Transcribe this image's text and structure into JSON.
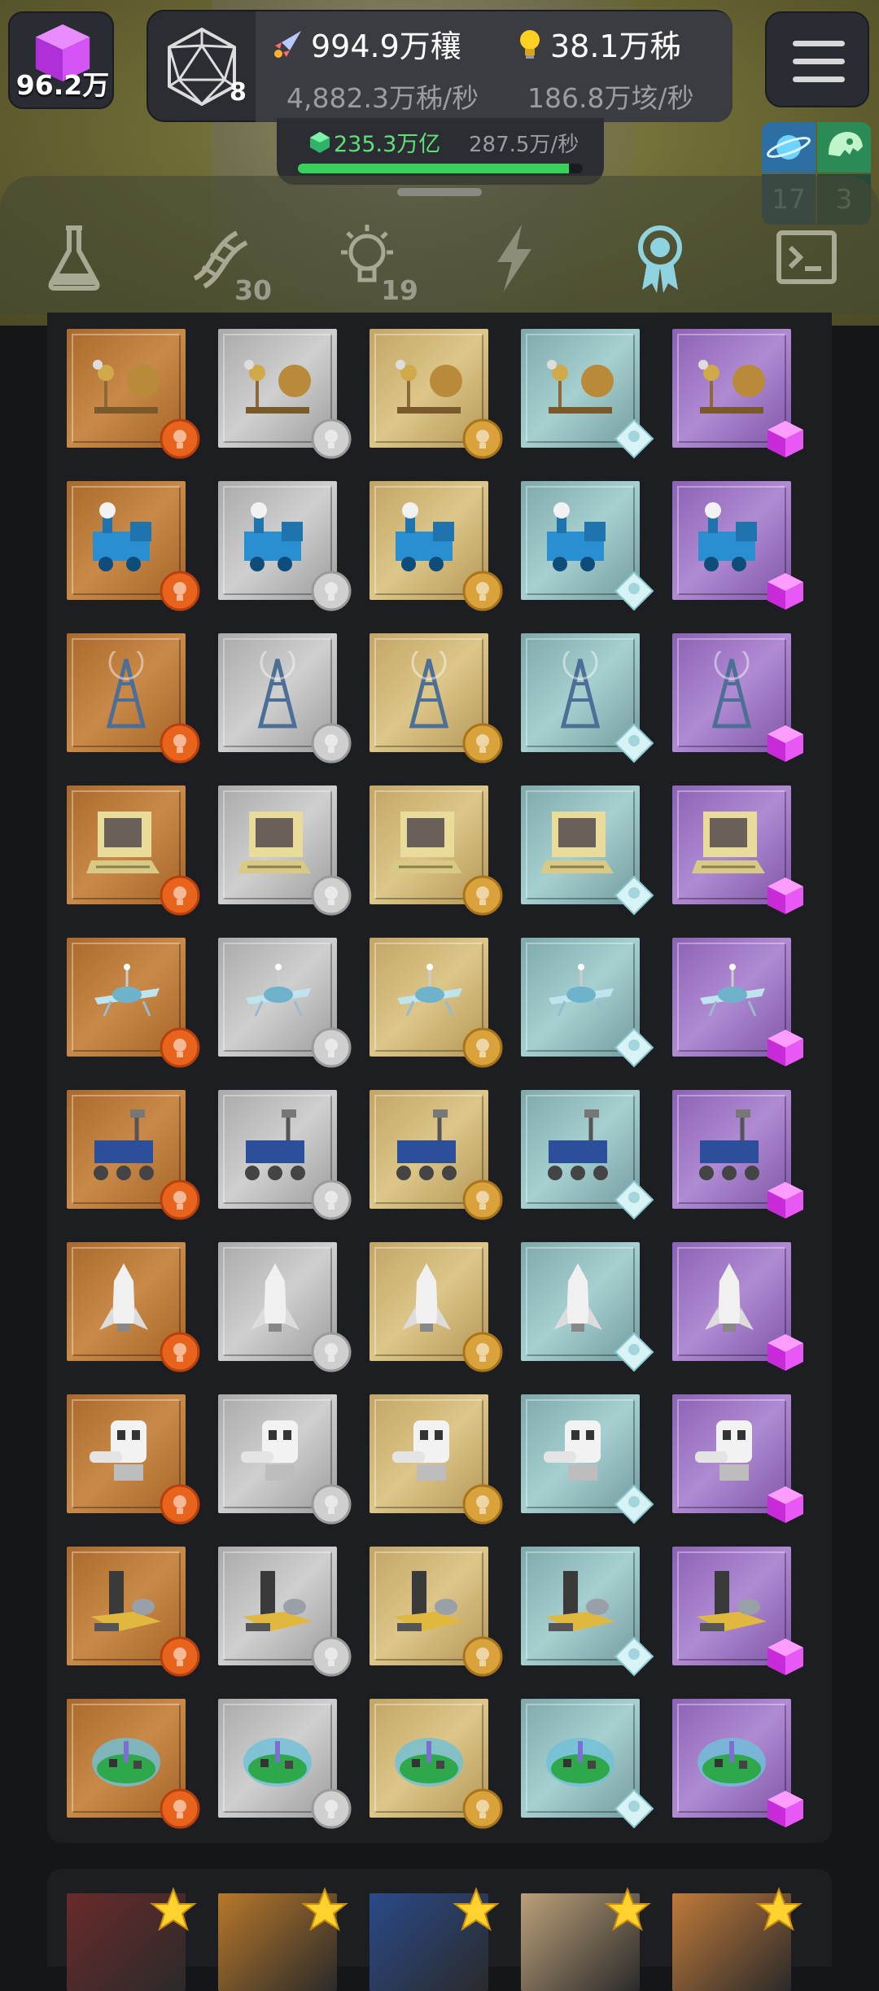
{
  "header": {
    "gem_value": "96.2万",
    "d20_level": "8",
    "resource_1_value": "994.9万穰",
    "resource_1_rate": "4,882.3万秭/秒",
    "resource_2_value": "38.1万秭",
    "resource_2_rate": "186.8万垓/秒",
    "energy_value": "235.3万亿",
    "energy_rate": "287.5万/秒",
    "energy_progress": 0.95
  },
  "side_badges": {
    "planet_count": "17",
    "dino_count": "3"
  },
  "tabs": [
    {
      "icon": "flask-icon",
      "count": "",
      "active": false
    },
    {
      "icon": "dna-icon",
      "count": "30",
      "active": false
    },
    {
      "icon": "lightbulb-icon",
      "count": "19",
      "active": false
    },
    {
      "icon": "lightning-icon",
      "count": "",
      "active": false
    },
    {
      "icon": "award-ribbon-icon",
      "count": "",
      "active": true
    },
    {
      "icon": "terminal-icon",
      "count": "",
      "active": false
    }
  ],
  "tiers": [
    "bronze",
    "silver",
    "gold",
    "diamond",
    "purple"
  ],
  "colors": {
    "bronze": "#b8783a",
    "silver": "#bdbdbd",
    "gold": "#cfb77a",
    "diamond": "#93bcbe",
    "purple": "#9f78c4",
    "accent_active_tab": "#8fd2e0",
    "progress_green": "#37d25a"
  },
  "achievement_rows": [
    {
      "item": "orrery-icon"
    },
    {
      "item": "steam-locomotive-icon"
    },
    {
      "item": "radio-tower-icon"
    },
    {
      "item": "personal-computer-icon"
    },
    {
      "item": "satellite-icon"
    },
    {
      "item": "rover-icon"
    },
    {
      "item": "space-shuttle-icon"
    },
    {
      "item": "robot-icon"
    },
    {
      "item": "refinery-icon"
    },
    {
      "item": "biodome-icon"
    }
  ],
  "bottom_cards": [
    {
      "icon": "creature-portrait-icon"
    },
    {
      "icon": "explosion-portrait-icon"
    },
    {
      "icon": "ocean-portrait-icon"
    },
    {
      "icon": "scientist-portrait-icon"
    },
    {
      "icon": "desert-portrait-icon"
    }
  ]
}
